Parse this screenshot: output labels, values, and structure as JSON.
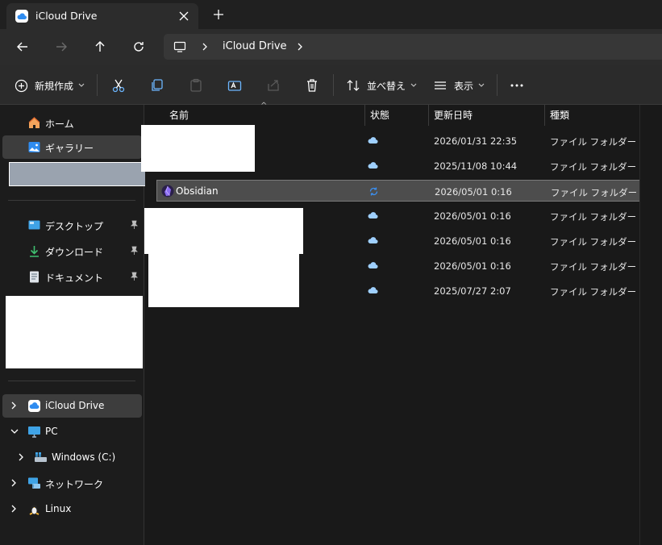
{
  "tab": {
    "title": "iCloud Drive",
    "close": "close-tab",
    "new": "new-tab"
  },
  "address": {
    "crumbs": [
      "iCloud Drive"
    ]
  },
  "toolbar": {
    "new_label": "新規作成",
    "sort_label": "並べ替え",
    "view_label": "表示",
    "icons": [
      "cut-icon",
      "copy-icon",
      "paste-icon",
      "rename-icon",
      "share-icon",
      "delete-icon"
    ]
  },
  "nav": {
    "home": "ホーム",
    "gallery": "ギャラリー",
    "desktop": "デスクトップ",
    "downloads": "ダウンロード",
    "documents": "ドキュメント",
    "icloud": "iCloud Drive",
    "pc": "PC",
    "windows": "Windows (C:)",
    "network": "ネットワーク",
    "linux": "Linux"
  },
  "columns": {
    "name": "名前",
    "status": "状態",
    "modified": "更新日時",
    "type": "種類"
  },
  "files": [
    {
      "name": "",
      "status": "cloud",
      "modified": "2026/01/31 22:35",
      "type": "ファイル フォルダー"
    },
    {
      "name": "",
      "status": "cloud",
      "modified": "2025/11/08 10:44",
      "type": "ファイル フォルダー"
    },
    {
      "name": "Obsidian",
      "status": "sync",
      "modified": "2026/05/01 0:16",
      "type": "ファイル フォルダー",
      "selected": true
    },
    {
      "name": "",
      "status": "cloud",
      "modified": "2026/05/01 0:16",
      "type": "ファイル フォルダー"
    },
    {
      "name": "",
      "status": "cloud",
      "modified": "2026/05/01 0:16",
      "type": "ファイル フォルダー"
    },
    {
      "name": "",
      "status": "cloud",
      "modified": "2026/05/01 0:16",
      "type": "ファイル フォルダー"
    },
    {
      "name": "",
      "status": "cloud",
      "modified": "2025/07/27 2:07",
      "type": "ファイル フォルダー"
    }
  ],
  "colors": {
    "accent": "#4aa3ff",
    "selection": "#4d4d4d",
    "background": "#191919",
    "obsidian": "#7c4dff"
  }
}
